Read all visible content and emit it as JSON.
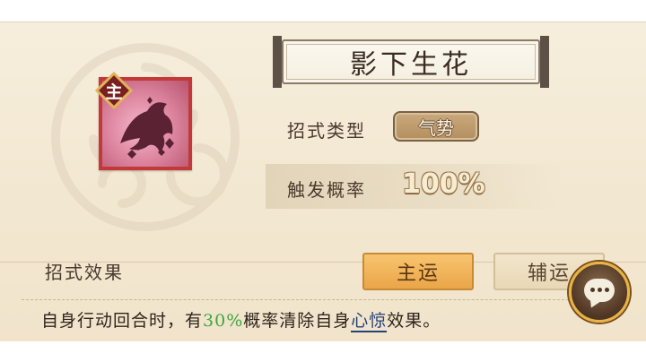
{
  "skill": {
    "name": "影下生花",
    "badge": "主",
    "type_label": "招式类型",
    "type_value": "气势",
    "rate_label": "触发概率",
    "rate_value": "100%"
  },
  "effect": {
    "label": "招式效果",
    "tabs": [
      {
        "label": "主运",
        "active": true
      },
      {
        "label": "辅运",
        "active": false
      }
    ],
    "text_before": "自身行动回合时，有",
    "highlight_percent": "30%",
    "text_middle": "概率清除自身",
    "keyword": "心惊",
    "text_after": "效果。"
  },
  "icons": {
    "skill_icon": "ninja-silhouette-icon",
    "chat": "chat-bubble-icon",
    "background": "cloud-swirl-icon"
  },
  "colors": {
    "panel_bg": "#f4ead6",
    "active_tab": "#f1b45a",
    "percent_green": "#3da63b",
    "keyword_blue": "#25407a"
  }
}
